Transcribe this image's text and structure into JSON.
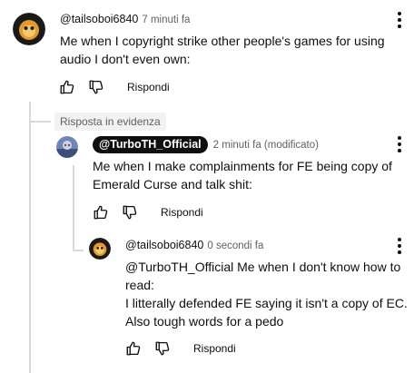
{
  "comments": [
    {
      "handle": "@tailsoboi6840",
      "time": "7 minuti fa",
      "lines": [
        "Me when I copyright strike other people's games for using",
        "audio I don't even own:"
      ],
      "reply_label": "Rispondi"
    },
    {
      "pinned_label": "Risposta in evidenza",
      "handle": "@TurboTH_Official",
      "time": "2 minuti fa (modificato)",
      "lines": [
        "Me when I make complainments for FE being copy of",
        "Emerald Curse and talk shit:"
      ],
      "reply_label": "Rispondi"
    },
    {
      "handle": "@tailsoboi6840",
      "time": "0 secondi fa",
      "lines": [
        "@TurboTH_Official Me when I don't know how to",
        "read:",
        "I litterally defended FE saying it isn't a copy of EC.",
        "Also tough words for a pedo"
      ],
      "reply_label": "Rispondi"
    }
  ],
  "icons": {
    "like": "thumbs-up-icon",
    "dislike": "thumbs-down-icon",
    "more": "more-vertical-icon"
  }
}
